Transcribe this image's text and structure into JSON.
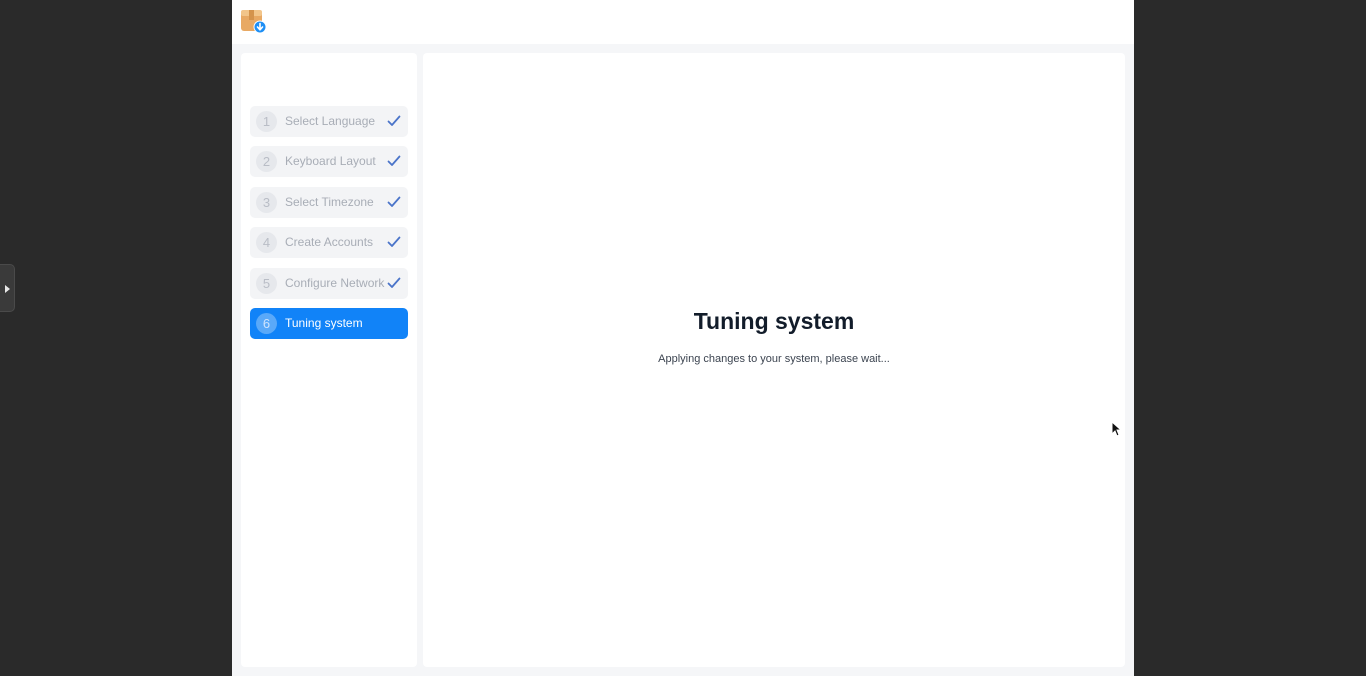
{
  "steps": [
    {
      "number": "1",
      "label": "Select Language",
      "completed": true
    },
    {
      "number": "2",
      "label": "Keyboard Layout",
      "completed": true
    },
    {
      "number": "3",
      "label": "Select Timezone",
      "completed": true
    },
    {
      "number": "4",
      "label": "Create Accounts",
      "completed": true
    },
    {
      "number": "5",
      "label": "Configure Network",
      "completed": true
    },
    {
      "number": "6",
      "label": "Tuning system",
      "completed": false,
      "active": true
    }
  ],
  "main": {
    "title": "Tuning system",
    "subtitle": "Applying changes to your system, please wait..."
  },
  "icons": {
    "app": "installer-package-icon",
    "step_done": "checkmark-icon",
    "side_toggle": "expand-arrow-icon",
    "cursor": "mouse-pointer-icon"
  },
  "colors": {
    "accent": "#1183f8",
    "check": "#4a74c9",
    "background": "#2a2a2a"
  }
}
